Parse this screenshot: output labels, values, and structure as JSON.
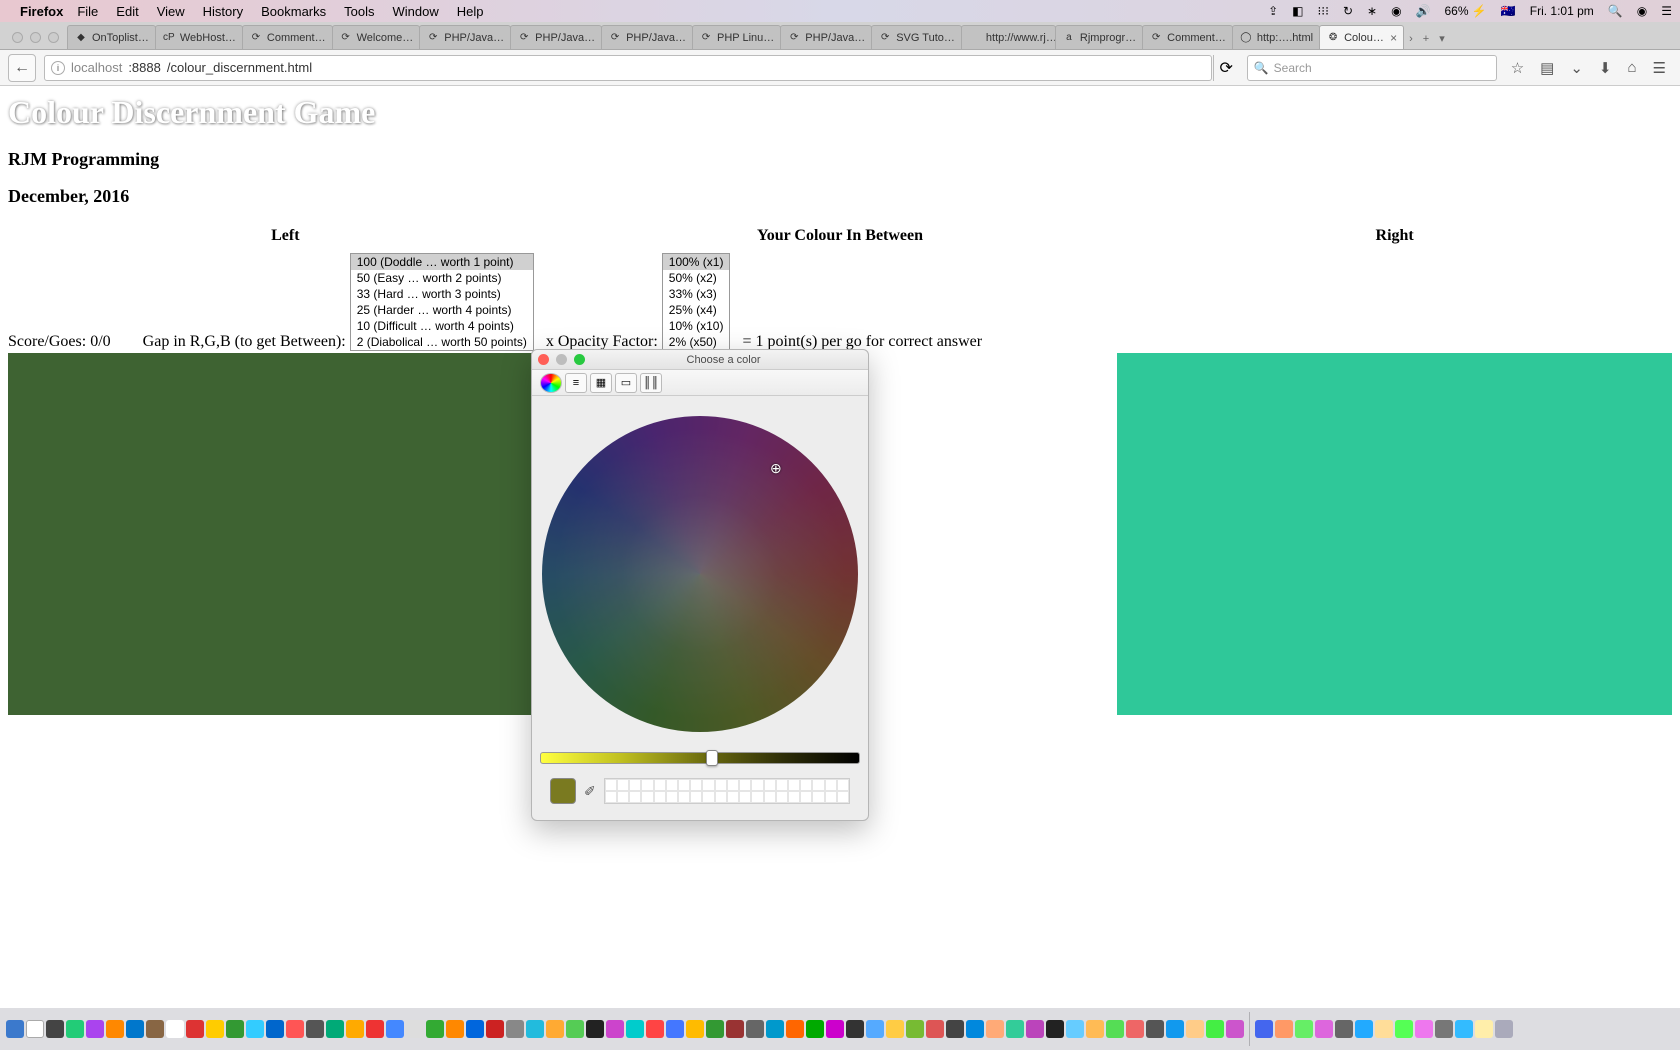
{
  "mac_menu": {
    "app": "Firefox",
    "items": [
      "File",
      "Edit",
      "View",
      "History",
      "Bookmarks",
      "Tools",
      "Window",
      "Help"
    ],
    "battery": "66%",
    "clock": "Fri. 1:01 pm"
  },
  "tabs": [
    {
      "label": "OnToplist…",
      "icon": "◆"
    },
    {
      "label": "WebHost…",
      "icon": "cP"
    },
    {
      "label": "Comment…",
      "icon": "⟳"
    },
    {
      "label": "Welcome…",
      "icon": "⟳"
    },
    {
      "label": "PHP/Java…",
      "icon": "⟳"
    },
    {
      "label": "PHP/Java…",
      "icon": "⟳"
    },
    {
      "label": "PHP/Java…",
      "icon": "⟳"
    },
    {
      "label": "PHP Linu…",
      "icon": "⟳"
    },
    {
      "label": "PHP/Java…",
      "icon": "⟳"
    },
    {
      "label": "SVG Tuto…",
      "icon": "⟳"
    },
    {
      "label": "http://www.rj…",
      "icon": ""
    },
    {
      "label": "Rjmprogr…",
      "icon": "a"
    },
    {
      "label": "Comment…",
      "icon": "⟳"
    },
    {
      "label": "http:….html",
      "icon": "◯"
    },
    {
      "label": "Colou…",
      "icon": "❂",
      "active": true
    }
  ],
  "url": {
    "host": "localhost",
    "port": ":8888",
    "path": "/colour_discernment.html"
  },
  "search_placeholder": "Search",
  "page": {
    "title": "Colour Discernment Game",
    "author": "RJM Programming",
    "date": "December, 2016",
    "headers": {
      "left": "Left",
      "mid": "Your Colour In Between",
      "right": "Right"
    },
    "score_label": "Score/Goes: 0/0",
    "gap_label": "Gap in R,G,B (to get Between):",
    "gap_options": [
      "100 (Doddle … worth 1 point)",
      "50 (Easy … worth 2 points)",
      "33 (Hard … worth 3 points)",
      "25 (Harder … worth 4 points)",
      "10 (Difficult … worth 4 points)",
      "2 (Diabolical … worth 50 points)"
    ],
    "gap_selected": 0,
    "opacity_label": "x Opacity Factor:",
    "opacity_options": [
      "100% (x1)",
      "50% (x2)",
      "33% (x3)",
      "25% (x4)",
      "10% (x10)",
      "2% (x50)"
    ],
    "opacity_selected": 0,
    "result_label": "= 1 point(s) per go for correct answer",
    "left_color": "#3e6332",
    "right_color": "#2fc899"
  },
  "color_picker": {
    "title": "Choose a color",
    "swatch": "#7a7a20"
  }
}
